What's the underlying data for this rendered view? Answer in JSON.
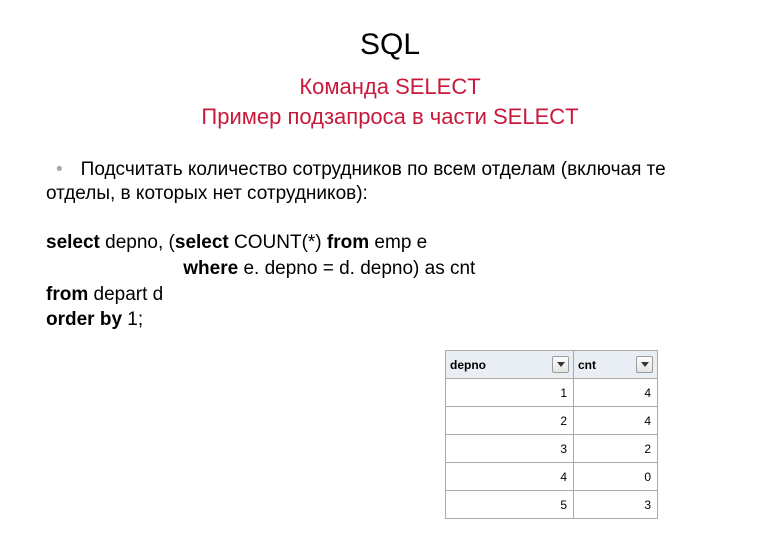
{
  "title_block": {
    "main": "SQL",
    "sub1": "Команда SELECT",
    "sub2": "Пример подзапроса в части SELECT"
  },
  "bullet": {
    "line1": "Подсчитать количество сотрудников по всем отделам (включая те",
    "line2": "отделы, в которых нет сотрудников):"
  },
  "code": {
    "kw_select": "select",
    "seg1": " depno, (",
    "kw_select2": "select",
    "seg2": " COUNT(*) ",
    "kw_from": "from",
    "seg3": " emp e",
    "indent": "                          ",
    "kw_where": "where",
    "seg_where": " e. depno = d. depno) as cnt",
    "kw_from2": "from",
    "seg_from2": " depart d",
    "kw_orderby": "order by",
    "seg_orderby": " 1;"
  },
  "table": {
    "headers": {
      "depno": "depno",
      "cnt": "cnt"
    },
    "rows": [
      {
        "depno": "1",
        "cnt": "4"
      },
      {
        "depno": "2",
        "cnt": "4"
      },
      {
        "depno": "3",
        "cnt": "2"
      },
      {
        "depno": "4",
        "cnt": "0"
      },
      {
        "depno": "5",
        "cnt": "3"
      }
    ]
  }
}
